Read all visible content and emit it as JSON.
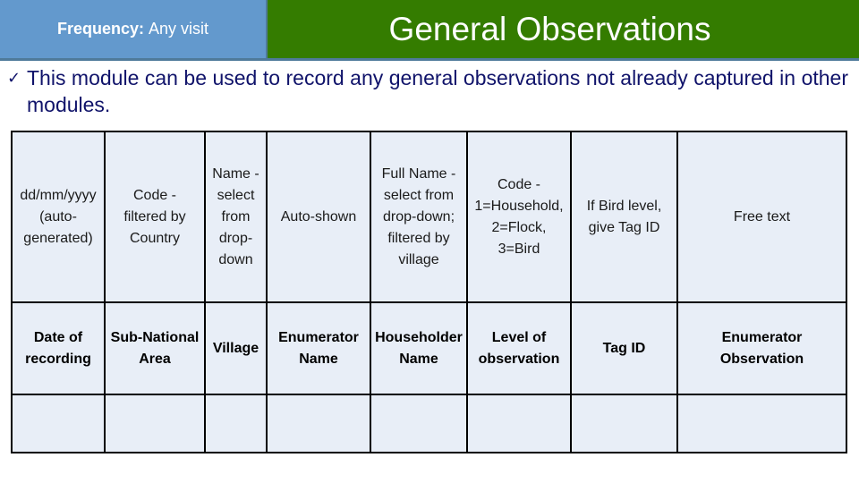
{
  "header": {
    "frequency_label": "Frequency:",
    "frequency_value": "Any visit",
    "title": "General Observations"
  },
  "bullet": {
    "icon": "check-icon",
    "text": "This module can be used to record any general observations not already captured in other modules."
  },
  "colors": {
    "frequency_bg": "#6399cd",
    "title_bg": "#347c00",
    "header_border": "#4f7a9a",
    "bullet_text": "#10136a",
    "table_bg": "#e8eef7"
  },
  "table": {
    "descriptions": [
      [
        "dd/mm/yyyy",
        "(auto-",
        "generated)"
      ],
      [
        "Code -",
        "filtered by",
        "Country"
      ],
      [
        "Name -",
        "select",
        "from",
        "drop-",
        "down"
      ],
      [
        "Auto-shown"
      ],
      [
        "Full Name -",
        "select from",
        "drop-down;",
        "filtered by",
        "village"
      ],
      [
        "Code -",
        "1=Household,",
        "2=Flock,",
        "3=Bird"
      ],
      [
        "If Bird level,",
        "give Tag ID"
      ],
      [
        "Free text"
      ]
    ],
    "headers": [
      [
        "Date of",
        "recording"
      ],
      [
        "Sub-National",
        "Area"
      ],
      [
        "Village"
      ],
      [
        "Enumerator",
        "Name"
      ],
      [
        "Householder",
        "Name"
      ],
      [
        "Level of",
        "observation"
      ],
      [
        "Tag ID"
      ],
      [
        "Enumerator",
        "Observation"
      ]
    ],
    "empty_row": [
      "",
      "",
      "",
      "",
      "",
      "",
      "",
      ""
    ]
  }
}
